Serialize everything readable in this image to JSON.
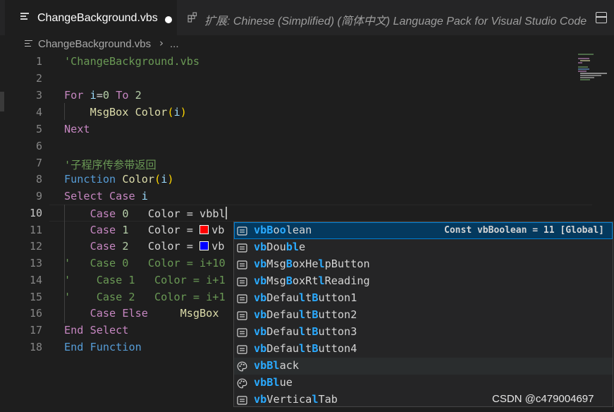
{
  "tabs": [
    {
      "label": "ChangeBackground.vbs",
      "icon": "lines-file-icon",
      "dirty": true
    },
    {
      "label": "扩展: Chinese (Simplified) (简体中文) Language Pack for Visual Studio Code",
      "icon": "extensions-icon"
    }
  ],
  "breadcrumb": {
    "file": "ChangeBackground.vbs",
    "separator": "›",
    "more": "..."
  },
  "colors": {
    "keyword": "#c586c0",
    "builtin": "#569cd6",
    "function": "#dcdcaa",
    "string": "#ce9178",
    "comment": "#6a9955",
    "number": "#b5cea8",
    "variable": "#9cdcfe",
    "bracket": "#ffd700",
    "highlight": "#2aaaff",
    "swatch_red": "#ff0000",
    "swatch_blue": "#0000ff"
  },
  "editor": {
    "active_line": 10,
    "lines": [
      {
        "n": "1"
      },
      {
        "n": "2"
      },
      {
        "n": "3"
      },
      {
        "n": "4"
      },
      {
        "n": "5"
      },
      {
        "n": "6"
      },
      {
        "n": "7"
      },
      {
        "n": "8"
      },
      {
        "n": "9"
      },
      {
        "n": "10"
      },
      {
        "n": "11"
      },
      {
        "n": "12"
      },
      {
        "n": "13"
      },
      {
        "n": "14"
      },
      {
        "n": "15"
      },
      {
        "n": "16"
      },
      {
        "n": "17"
      },
      {
        "n": "18"
      }
    ],
    "l1": "'ChangeBackground.vbs",
    "l3": {
      "kw_for": "For",
      "var": "i",
      "eq": "=",
      "n0": "0",
      "kw_to": "To",
      "n2": "2"
    },
    "l4": {
      "fn_msgbox": "MsgBox",
      "fn_color": "Color",
      "arg": "i"
    },
    "l5": {
      "kw_next": "Next"
    },
    "l7": "'子程序传参带返回",
    "l8": {
      "kw_function": "Function",
      "fn_color": "Color",
      "arg": "i"
    },
    "l9": {
      "kw_select": "Select",
      "kw_case": "Case",
      "var": "i"
    },
    "l10": {
      "kw_case": "Case",
      "num": "0",
      "assign": "Color = vbbl"
    },
    "l11": {
      "kw_case": "Case",
      "num": "1",
      "assign": "Color =",
      "tail": "vb"
    },
    "l12": {
      "kw_case": "Case",
      "num": "2",
      "assign": "Color =",
      "tail": "vb"
    },
    "l13": "'   Case 0   Color = i+10",
    "l14": "'    Case 1   Color = i+1",
    "l15": "'    Case 2   Color = i+1",
    "l16": {
      "kw_case": "Case",
      "kw_else": "Else",
      "fn_msgbox": "MsgBox"
    },
    "l17": {
      "kw_end": "End",
      "kw_select": "Select"
    },
    "l18": {
      "kw_end": "End",
      "kw_function": "Function"
    }
  },
  "suggest": {
    "items": [
      {
        "parts": [
          "vbB",
          "o",
          "o",
          "lean"
        ],
        "icon": "constant-icon",
        "detail": "Const vbBoolean = 11 [Global]",
        "state": "focused"
      },
      {
        "parts": [
          "vbDou",
          "b",
          "",
          "le"
        ],
        "icon": "constant-icon"
      },
      {
        "label": "vbMsgBoxHelpButton",
        "icon": "constant-icon"
      },
      {
        "label": "vbMsgBoxRtlReading",
        "icon": "constant-icon"
      },
      {
        "label": "vbDefaultButton1",
        "icon": "constant-icon"
      },
      {
        "label": "vbDefaultButton2",
        "icon": "constant-icon"
      },
      {
        "label": "vbDefaultButton3",
        "icon": "constant-icon"
      },
      {
        "label": "vbDefaultButton4",
        "icon": "constant-icon"
      },
      {
        "label": "vbBlack",
        "icon": "color-palette-icon",
        "state": "hover"
      },
      {
        "label": "vbBlue",
        "icon": "color-palette-icon"
      },
      {
        "label": "vbVerticalTab",
        "icon": "constant-icon"
      }
    ]
  },
  "watermark": "CSDN @c479004697"
}
